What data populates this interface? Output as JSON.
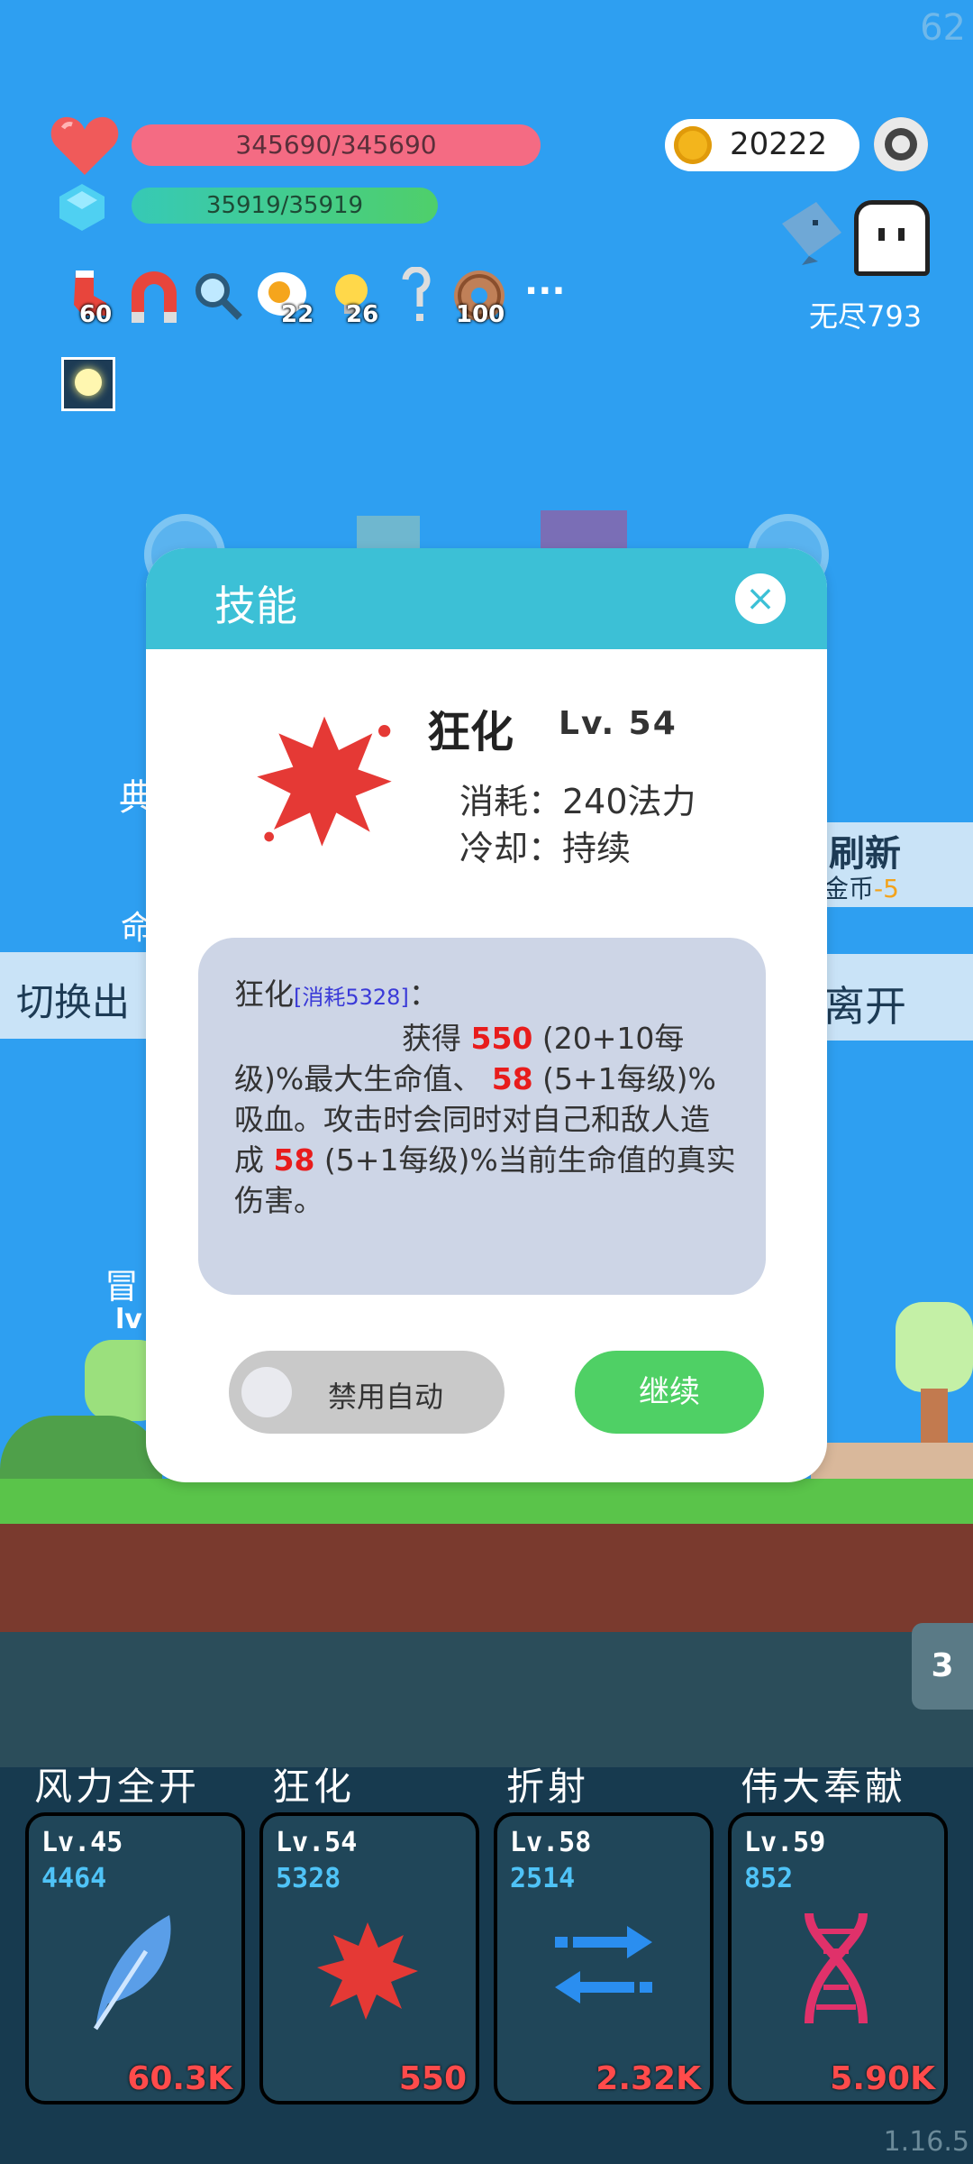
{
  "fps": "62",
  "hud": {
    "hp_text": "345690/345690",
    "mp_text": "35919/35919",
    "coins": "20222",
    "endless_label": "无尽793",
    "buffs": [
      {
        "icon": "sock-icon",
        "count": "60"
      },
      {
        "icon": "magnet-icon",
        "count": ""
      },
      {
        "icon": "magnifier-icon",
        "count": ""
      },
      {
        "icon": "fried-egg-icon",
        "count": "22"
      },
      {
        "icon": "lightbulb-icon",
        "count": "26"
      },
      {
        "icon": "hook-icon",
        "count": ""
      },
      {
        "icon": "donut-icon",
        "count": "100"
      }
    ],
    "more": "···"
  },
  "background": {
    "refresh_label": "刷新",
    "refresh_cost_label": "金币",
    "refresh_cost_value": "-5",
    "switch_label": "切换出",
    "leave_label": "离开",
    "left_char_1": "典",
    "left_char_2": "命",
    "adventurer_label": "冒",
    "lv_label": "lv",
    "queue_count": "3",
    "version": "1.16.5"
  },
  "dialog": {
    "title": "技能",
    "close_icon": "×",
    "skill_name": "狂化",
    "skill_level": "Lv. 54",
    "cost_line": "消耗：240法力",
    "cooldown_line": "冷却：持续",
    "desc": {
      "name": "狂化",
      "consume_tag": "[消耗5328]",
      "colon": "：",
      "p1": "获得 ",
      "v1": "550",
      "p2": " (20+10每级)%最大生命值、 ",
      "v2": "58",
      "p3": " (5+1每级)%吸血。攻击时会同时对自己和敌人造成 ",
      "v3": "58",
      "p4": " (5+1每级)%当前生命值的真实伤害。"
    },
    "toggle_label": "禁用自动",
    "continue_label": "继续"
  },
  "skills": [
    {
      "name": "风力全开",
      "level": "Lv.45",
      "cost": "4464",
      "value": "60.3K",
      "icon": "feather-icon"
    },
    {
      "name": "狂化",
      "level": "Lv.54",
      "cost": "5328",
      "value": "550",
      "icon": "red-splat-icon"
    },
    {
      "name": "折射",
      "level": "Lv.58",
      "cost": "2514",
      "value": "2.32K",
      "icon": "swap-arrows-icon"
    },
    {
      "name": "伟大奉献",
      "level": "Lv.59",
      "cost": "852",
      "value": "5.90K",
      "icon": "dna-icon"
    }
  ],
  "colors": {
    "sky": "#2e9ff1",
    "hp_bar": "#f46b83",
    "mp_bar": "#3fc8a2",
    "dialog_header": "#3cc0d6",
    "continue_button": "#4fd065",
    "highlight": "#e81c1c"
  }
}
